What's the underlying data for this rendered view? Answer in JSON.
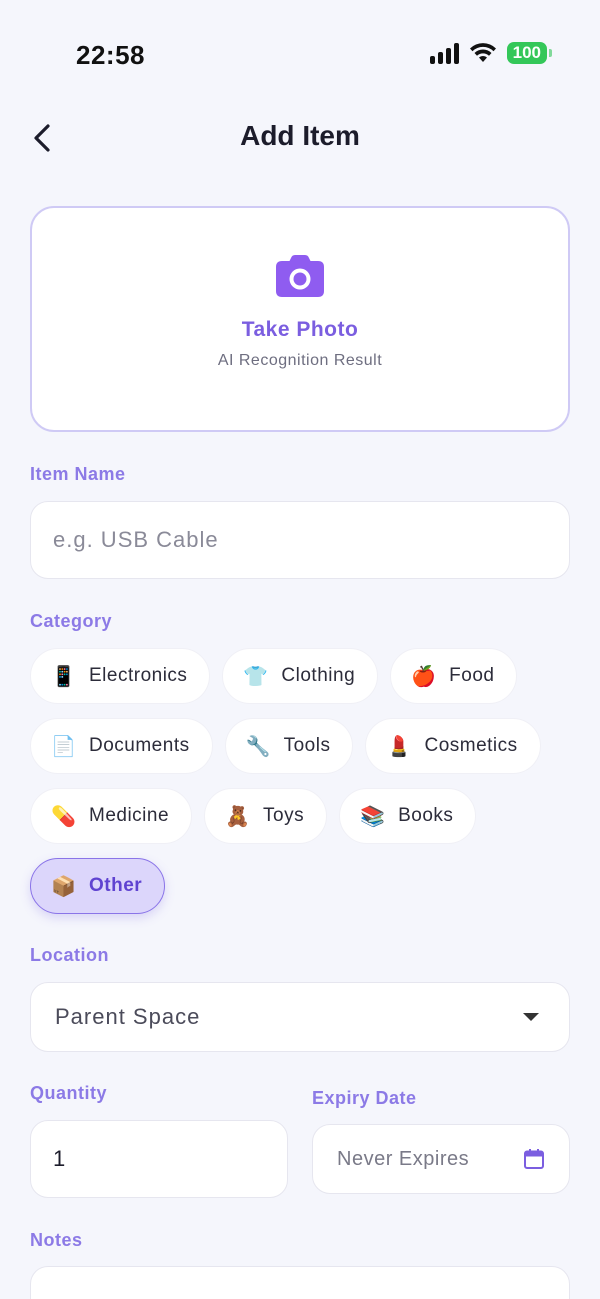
{
  "status_bar": {
    "time": "22:58",
    "battery": "100",
    "battery_color": "#34c759"
  },
  "header": {
    "title": "Add Item",
    "back_icon": "chevron-left-icon"
  },
  "photo": {
    "title": "Take Photo",
    "subtitle": "AI Recognition Result",
    "icon": "camera-icon",
    "accent": "#7b5ee0"
  },
  "item_name": {
    "label": "Item Name",
    "value": "",
    "placeholder": "e.g. USB Cable"
  },
  "category": {
    "label": "Category",
    "selected": "Other",
    "rows": [
      [
        {
          "emoji": "📱",
          "label": "Electronics"
        },
        {
          "emoji": "👕",
          "label": "Clothing"
        },
        {
          "emoji": "🍎",
          "label": "Food"
        }
      ],
      [
        {
          "emoji": "📄",
          "label": "Documents"
        },
        {
          "emoji": "🔧",
          "label": "Tools"
        },
        {
          "emoji": "💄",
          "label": "Cosmetics"
        }
      ],
      [
        {
          "emoji": "💊",
          "label": "Medicine"
        },
        {
          "emoji": "🧸",
          "label": "Toys"
        },
        {
          "emoji": "📚",
          "label": "Books"
        }
      ],
      [
        {
          "emoji": "📦",
          "label": "Other"
        }
      ]
    ]
  },
  "location": {
    "label": "Location",
    "value": "Parent Space"
  },
  "quantity": {
    "label": "Quantity",
    "value": "1"
  },
  "expiry": {
    "label": "Expiry Date",
    "value": "Never Expires",
    "icon": "calendar-icon"
  },
  "notes": {
    "label": "Notes",
    "value": ""
  }
}
